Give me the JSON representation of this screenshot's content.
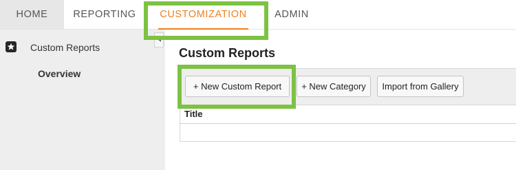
{
  "nav": {
    "tabs": [
      {
        "label": "HOME"
      },
      {
        "label": "REPORTING"
      },
      {
        "label": "CUSTOMIZATION",
        "active": true
      },
      {
        "label": "ADMIN"
      }
    ]
  },
  "sidebar": {
    "section": {
      "label": "Custom Reports",
      "icon": "star-icon"
    },
    "items": [
      {
        "label": "Overview",
        "selected": true
      }
    ]
  },
  "main": {
    "title": "Custom Reports",
    "toolbar": {
      "new_report_label": "+ New Custom Report",
      "new_category_label": "+ New Category",
      "import_label": "Import from Gallery"
    },
    "table": {
      "columns": [
        "Title"
      ]
    }
  },
  "colors": {
    "accent": "#f07f1c",
    "highlight": "#7dc243"
  }
}
